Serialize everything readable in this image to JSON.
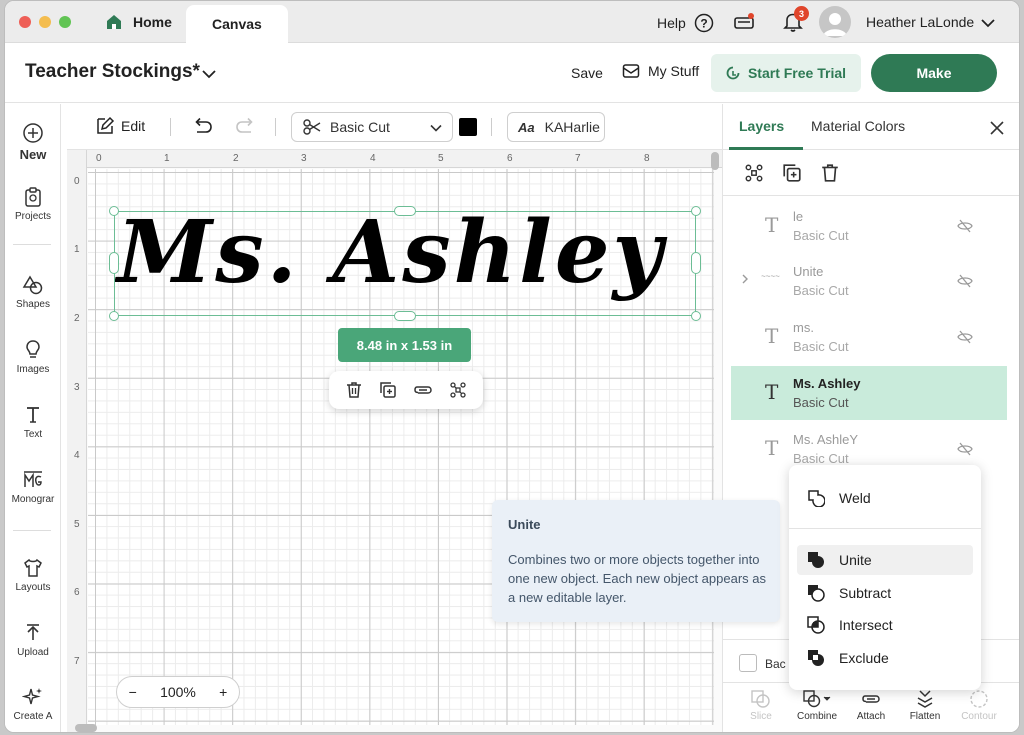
{
  "titlebar": {
    "tab_home": "Home",
    "tab_canvas": "Canvas",
    "help": "Help",
    "notifications_count": "3",
    "user_name": "Heather LaLonde"
  },
  "header": {
    "project_title": "Teacher Stockings*",
    "save": "Save",
    "my_stuff": "My Stuff",
    "start_trial": "Start Free Trial",
    "make": "Make",
    "accent_color": "#2f7a55"
  },
  "sidebar": {
    "items": [
      {
        "label": "New",
        "icon": "plus-circle-icon"
      },
      {
        "label": "Projects",
        "icon": "projects-icon"
      },
      {
        "label": "Shapes",
        "icon": "shapes-icon"
      },
      {
        "label": "Images",
        "icon": "lightbulb-icon"
      },
      {
        "label": "Text",
        "icon": "text-icon"
      },
      {
        "label": "Monograr",
        "icon": "monogram-icon"
      },
      {
        "label": "Layouts",
        "icon": "shirt-icon"
      },
      {
        "label": "Upload",
        "icon": "upload-icon"
      },
      {
        "label": "Create A",
        "icon": "sparkle-icon"
      }
    ]
  },
  "toolbar": {
    "edit": "Edit",
    "operation": "Basic Cut",
    "operation_color": "#000000",
    "font_prefix": "Aa",
    "font_name": "KAHarlie"
  },
  "canvas": {
    "ruler_top": [
      "0",
      "1",
      "2",
      "3",
      "4",
      "5",
      "6",
      "7",
      "8"
    ],
    "ruler_left": [
      "0",
      "1",
      "2",
      "3",
      "4",
      "5",
      "6",
      "7"
    ],
    "text_content": "Ms.  Ashley",
    "dimensions": "8.48  in x 1.53  in",
    "zoom": "100%",
    "zoom_minus": "−",
    "zoom_plus": "+"
  },
  "panel": {
    "tab_layers": "Layers",
    "tab_material": "Material Colors",
    "layers": [
      {
        "name": "le",
        "sub": "Basic Cut",
        "icon": "text-layer-icon",
        "hidden": true
      },
      {
        "name": "Unite",
        "sub": "Basic Cut",
        "icon": "group-layer-icon",
        "hidden": true
      },
      {
        "name": "ms.",
        "sub": "Basic Cut",
        "icon": "text-layer-icon",
        "hidden": true
      },
      {
        "name": "Ms. Ashley",
        "sub": "Basic Cut",
        "icon": "text-layer-icon",
        "hidden": false,
        "selected": true
      },
      {
        "name": "Ms. AshleY",
        "sub": "Basic Cut",
        "icon": "text-layer-icon",
        "hidden": true
      }
    ],
    "back_label": "Bac",
    "bottom_actions": [
      {
        "label": "Slice",
        "disabled": true
      },
      {
        "label": "Combine",
        "disabled": false
      },
      {
        "label": "Attach",
        "disabled": false
      },
      {
        "label": "Flatten",
        "disabled": false
      },
      {
        "label": "Contour",
        "disabled": true
      }
    ]
  },
  "combine_menu": {
    "items": [
      "Weld",
      "Unite",
      "Subtract",
      "Intersect",
      "Exclude"
    ],
    "highlighted": "Unite"
  },
  "tooltip": {
    "title": "Unite",
    "body": "Combines two or more objects together into one new object. Each new object appears as a new editable layer."
  }
}
